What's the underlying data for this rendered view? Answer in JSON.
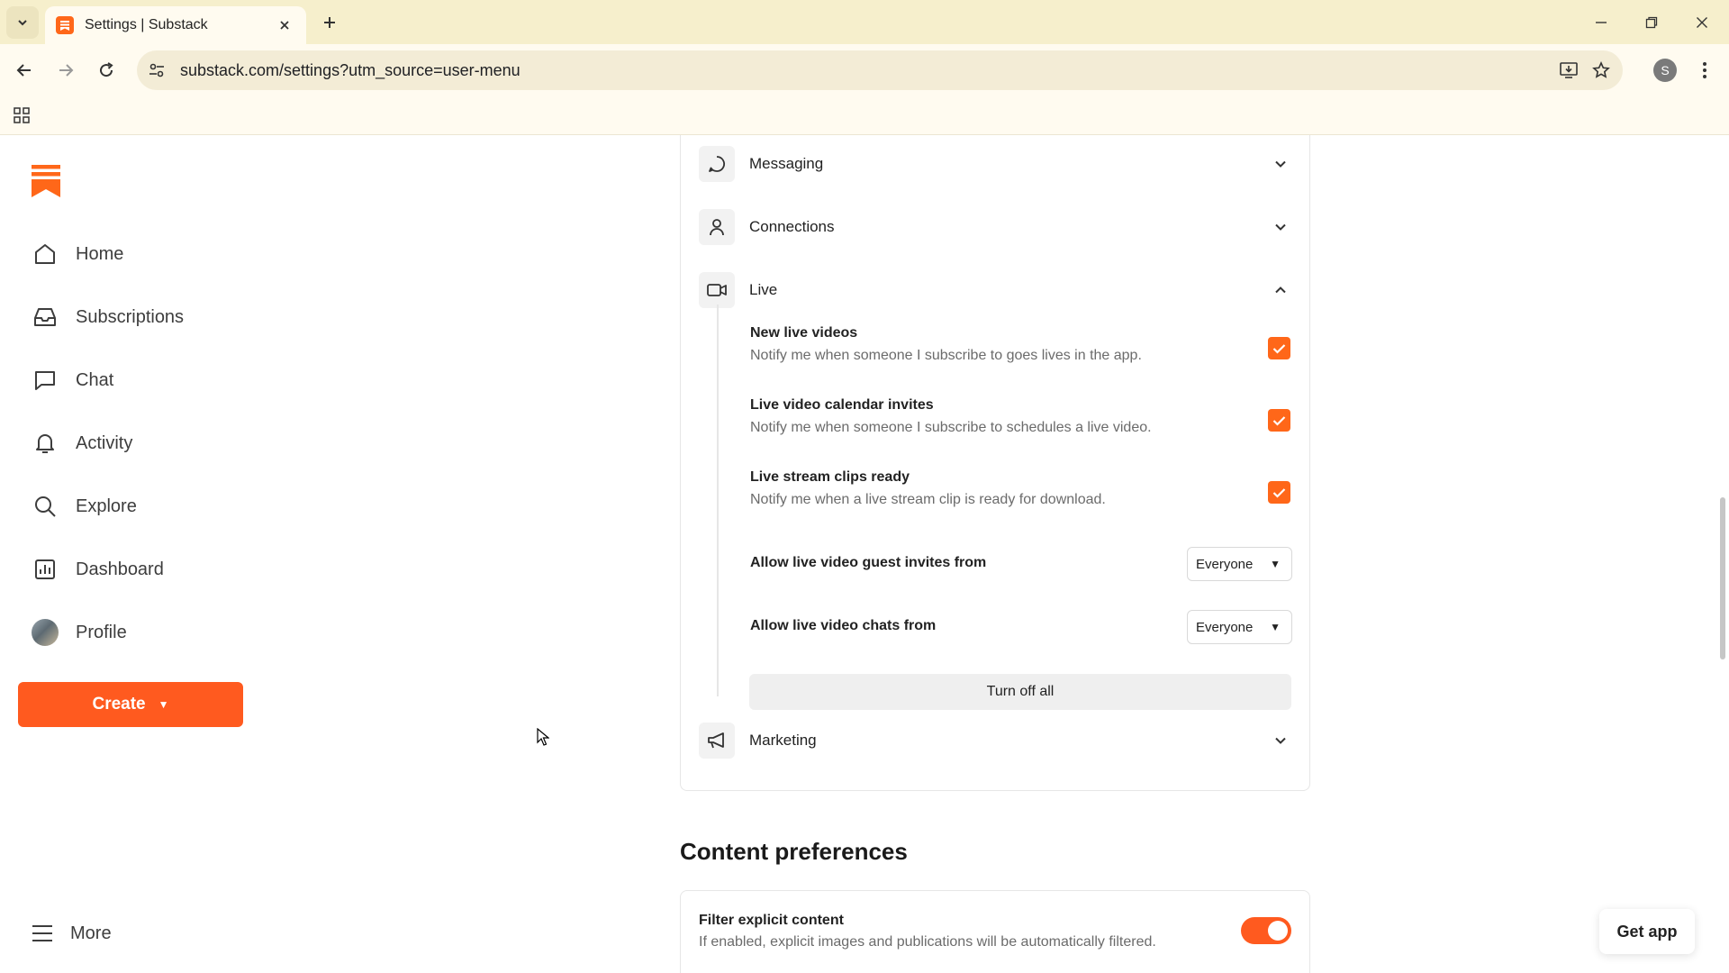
{
  "browser": {
    "tab_title": "Settings | Substack",
    "url": "substack.com/settings?utm_source=user-menu",
    "profile_initial": "S"
  },
  "sidebar": {
    "items": [
      {
        "label": "Home",
        "icon": "home-icon"
      },
      {
        "label": "Subscriptions",
        "icon": "inbox-icon"
      },
      {
        "label": "Chat",
        "icon": "chat-bubble-icon"
      },
      {
        "label": "Activity",
        "icon": "bell-icon"
      },
      {
        "label": "Explore",
        "icon": "search-icon"
      },
      {
        "label": "Dashboard",
        "icon": "bar-chart-icon"
      },
      {
        "label": "Profile",
        "icon": "profile-avatar"
      }
    ],
    "create_label": "Create",
    "more_label": "More"
  },
  "notifications": {
    "sections": [
      {
        "label": "Messaging",
        "icon": "message-icon",
        "expanded": false
      },
      {
        "label": "Connections",
        "icon": "person-icon",
        "expanded": false
      },
      {
        "label": "Live",
        "icon": "video-camera-icon",
        "expanded": true
      },
      {
        "label": "Marketing",
        "icon": "megaphone-icon",
        "expanded": false
      }
    ],
    "live": {
      "options": [
        {
          "title": "New live videos",
          "desc": "Notify me when someone I subscribe to goes lives in the app.",
          "checked": true
        },
        {
          "title": "Live video calendar invites",
          "desc": "Notify me when someone I subscribe to schedules a live video.",
          "checked": true
        },
        {
          "title": "Live stream clips ready",
          "desc": "Notify me when a live stream clip is ready for download.",
          "checked": true
        }
      ],
      "selects": [
        {
          "label": "Allow live video guest invites from",
          "value": "Everyone"
        },
        {
          "label": "Allow live video chats from",
          "value": "Everyone"
        }
      ],
      "turn_off_label": "Turn off all"
    }
  },
  "content_preferences": {
    "heading": "Content preferences",
    "filter_title": "Filter explicit content",
    "filter_desc": "If enabled, explicit images and publications will be automatically filtered.",
    "filter_enabled": true
  },
  "get_app_label": "Get app",
  "colors": {
    "accent": "#ff6719",
    "create_button": "#ff5a1f",
    "browser_frame": "#f6efcc"
  }
}
